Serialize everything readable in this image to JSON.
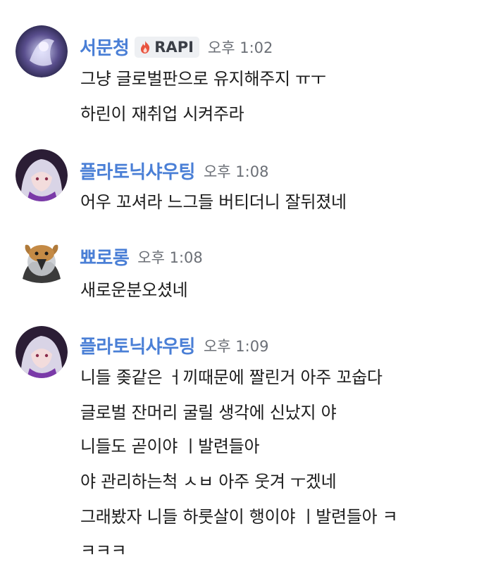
{
  "colors": {
    "username": "#4a7fd6",
    "timestamp": "#6b6f76",
    "badge_bg": "#eef0f3",
    "badge_icon": "#e8533f"
  },
  "messages": [
    {
      "username": "서문청",
      "badge": {
        "icon": "fire-icon",
        "label": "RAPI"
      },
      "time": "오후 1:02",
      "lines": [
        "그냥 글로벌판으로 유지해주지 ㅠㅜ",
        "하린이 재취업 시켜주라"
      ]
    },
    {
      "username": "플라토닉샤우팅",
      "time": "오후 1:08",
      "lines": [
        "어우 꼬셔라 느그들 버티더니 잘뒤졌네"
      ]
    },
    {
      "username": "뾰로롱",
      "time": "오후 1:08",
      "lines": [
        "새로운분오셨네"
      ]
    },
    {
      "username": "플라토닉샤우팅",
      "time": "오후 1:09",
      "lines": [
        "니들 좆같은  ㅓ끼때문에 짤린거 아주 꼬숩다",
        "글로벌 잔머리 굴릴 생각에 신났지          야",
        "니들도 곧이야  ㅣ발련들아",
        "야 관리하는척 ㅅㅂ 아주 웃겨  ㅜ겠네",
        "그래봤자 니들 하룻살이 행이야  ㅣ발련들아 ㅋ",
        "ㅋㅋㅋ"
      ]
    }
  ]
}
